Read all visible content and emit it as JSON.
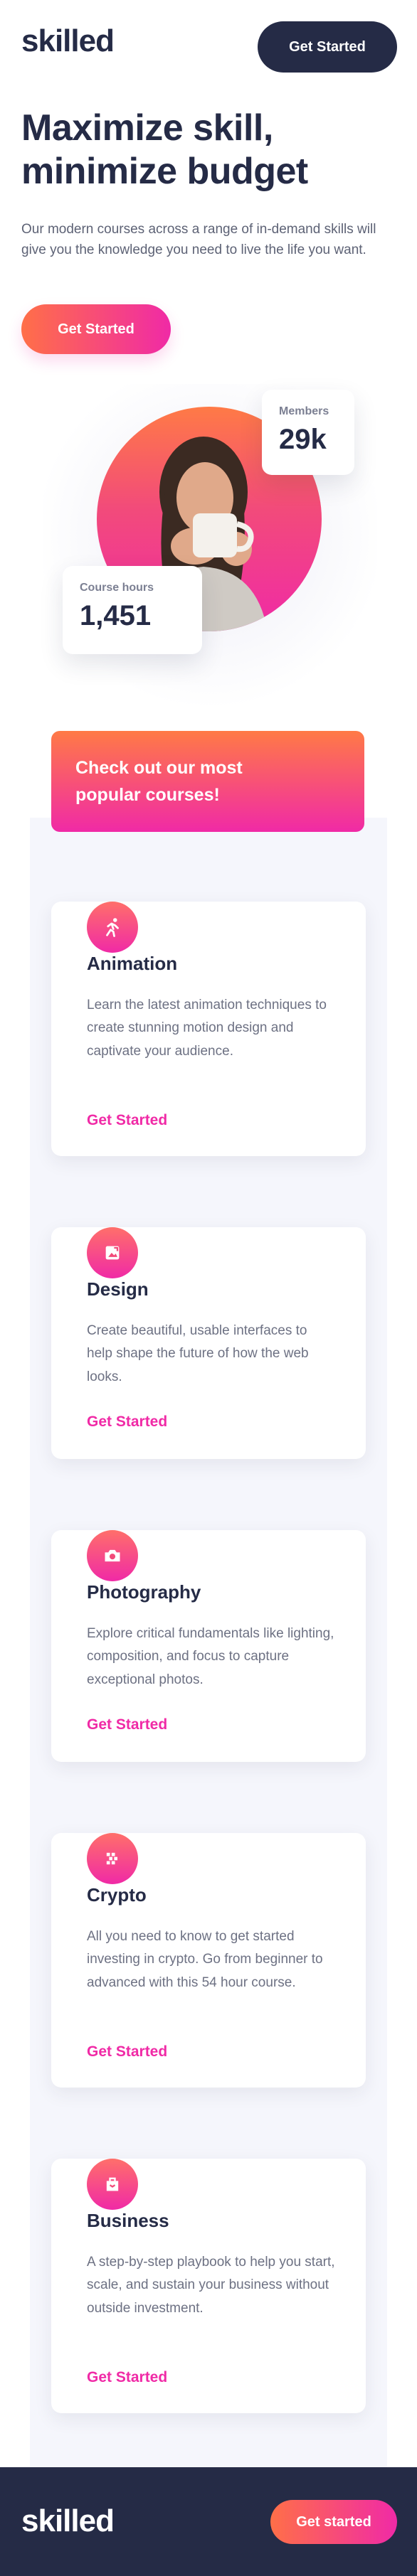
{
  "header": {
    "logo": "skilled",
    "cta_label": "Get Started"
  },
  "hero": {
    "title": "Maximize skill, minimize budget",
    "text": "Our modern courses across a range of in-demand skills will give you the knowledge you need to live the life you want.",
    "cta_label": "Get Started",
    "members_label": "Members",
    "members_value": "29k",
    "hours_label": "Course hours",
    "hours_value": "1,451"
  },
  "courses": {
    "promo": "Check out our most popular courses!",
    "items": [
      {
        "icon": "running-figure-icon",
        "title": "Animation",
        "text": "Learn the latest animation techniques to create stunning motion design and captivate your audience.",
        "link": "Get Started"
      },
      {
        "icon": "design-icon",
        "title": "Design",
        "text": "Create beautiful, usable interfaces to help shape the future of how the web looks.",
        "link": "Get Started"
      },
      {
        "icon": "camera-icon",
        "title": "Photography",
        "text": "Explore critical fundamentals like lighting, composition, and focus to capture exceptional photos.",
        "link": "Get Started"
      },
      {
        "icon": "crypto-icon",
        "title": "Crypto",
        "text": "All you need to know to get started investing in crypto. Go from beginner to advanced with this 54 hour course.",
        "link": "Get Started"
      },
      {
        "icon": "briefcase-icon",
        "title": "Business",
        "text": "A step-by-step playbook to help you start, scale, and sustain your business without outside investment.",
        "link": "Get Started"
      }
    ]
  },
  "footer": {
    "logo": "skilled",
    "cta_label": "Get started"
  },
  "colors": {
    "navy": "#252b46",
    "pink": "#f02aa6",
    "orange": "#ff6f48",
    "band": "#f5f6fc"
  }
}
